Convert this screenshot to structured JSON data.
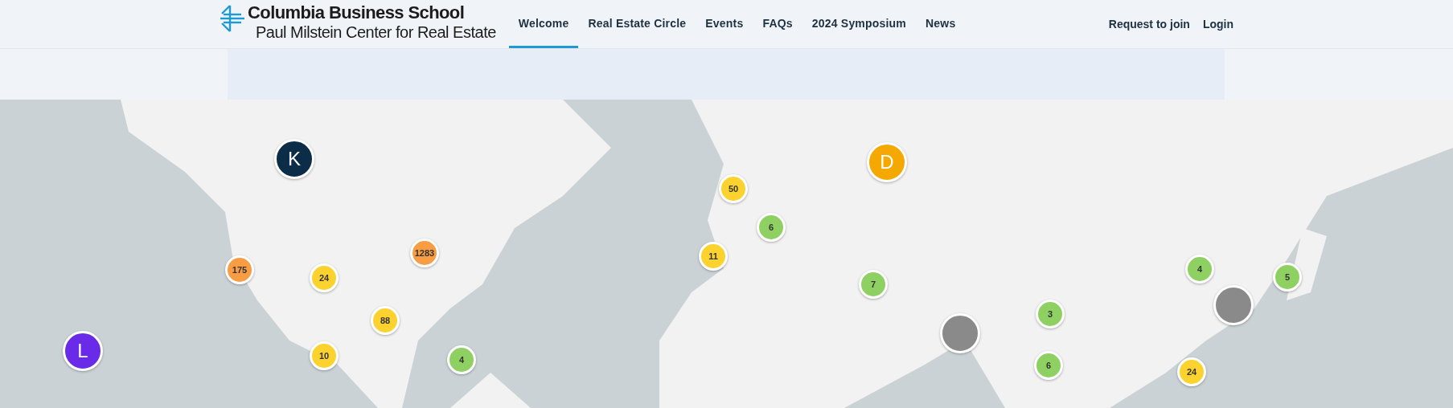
{
  "header": {
    "logo": {
      "title": "Columbia Business School",
      "subtitle": "Paul Milstein Center for Real Estate"
    },
    "nav": [
      {
        "label": "Welcome",
        "selected": true
      },
      {
        "label": "Real Estate Circle",
        "selected": false
      },
      {
        "label": "Events",
        "selected": false
      },
      {
        "label": "FAQs",
        "selected": false
      },
      {
        "label": "2024 Symposium",
        "selected": false
      },
      {
        "label": "News",
        "selected": false
      }
    ],
    "account_links": [
      "Request to join",
      "Login"
    ]
  },
  "map": {
    "markers": [
      {
        "kind": "letter",
        "text": "K",
        "color": "#0c2d48"
      },
      {
        "kind": "letter",
        "text": "L",
        "color": "#6a2be8"
      },
      {
        "kind": "letter",
        "text": "D",
        "color": "#f5a800"
      },
      {
        "kind": "cluster",
        "text": "175",
        "color": "#f99d45"
      },
      {
        "kind": "cluster",
        "text": "24",
        "color": "#fbd22e"
      },
      {
        "kind": "cluster",
        "text": "1283",
        "color": "#f99d45"
      },
      {
        "kind": "cluster",
        "text": "88",
        "color": "#fbd22e"
      },
      {
        "kind": "cluster",
        "text": "10",
        "color": "#fbd22e"
      },
      {
        "kind": "cluster",
        "text": "4",
        "color": "#8fd062"
      },
      {
        "kind": "cluster",
        "text": "50",
        "color": "#fbd22e"
      },
      {
        "kind": "cluster",
        "text": "6",
        "color": "#8fd062"
      },
      {
        "kind": "cluster",
        "text": "11",
        "color": "#fbd22e"
      },
      {
        "kind": "cluster",
        "text": "7",
        "color": "#8fd062"
      },
      {
        "kind": "photo"
      },
      {
        "kind": "cluster",
        "text": "3",
        "color": "#8fd062"
      },
      {
        "kind": "cluster",
        "text": "6",
        "color": "#8fd062"
      },
      {
        "kind": "cluster",
        "text": "4",
        "color": "#8fd062"
      },
      {
        "kind": "cluster",
        "text": "5",
        "color": "#8fd062"
      },
      {
        "kind": "photo"
      },
      {
        "kind": "cluster",
        "text": "24",
        "color": "#fbd22e"
      }
    ]
  }
}
